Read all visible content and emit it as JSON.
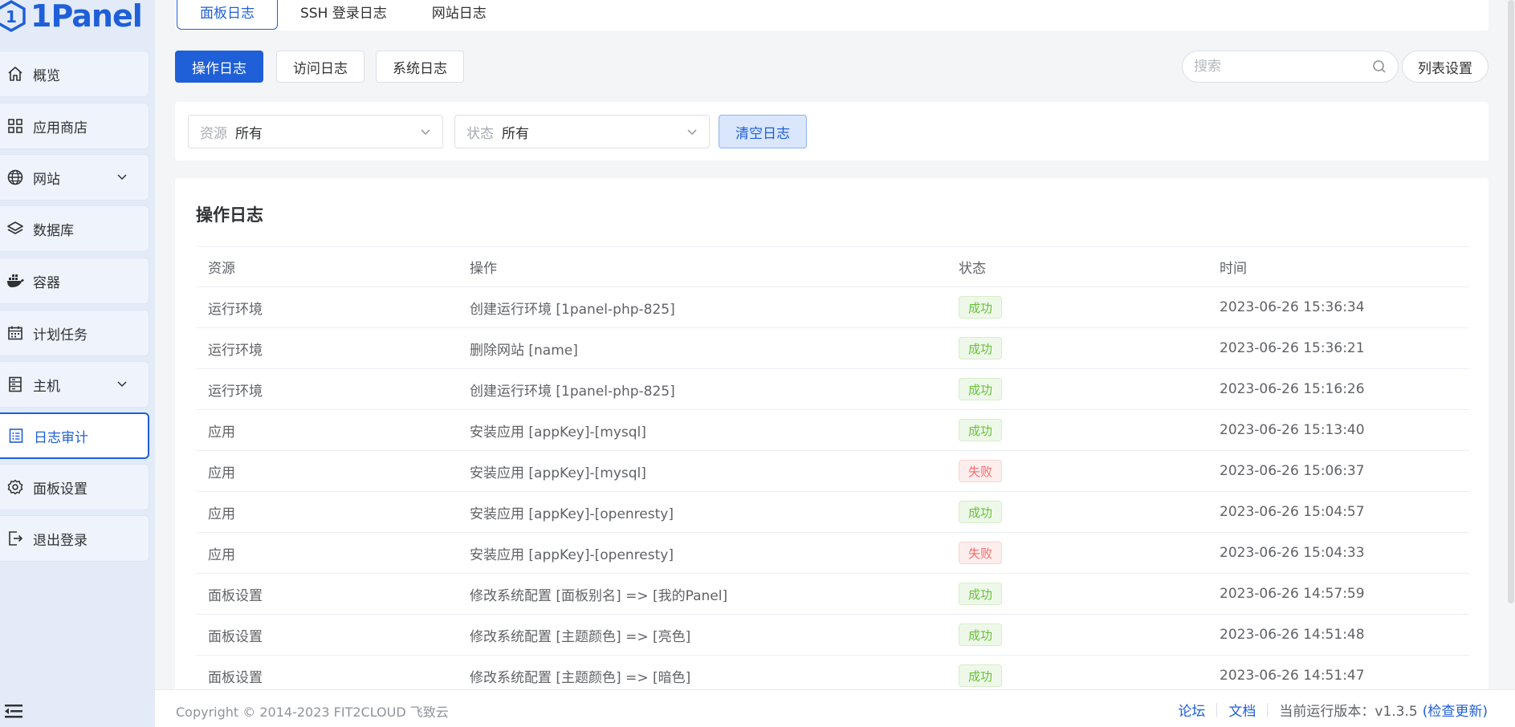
{
  "app": {
    "logo_text": "1Panel"
  },
  "sidebar": {
    "items": [
      {
        "label": "概览",
        "icon": "home-icon",
        "has_arrow": false,
        "active": false
      },
      {
        "label": "应用商店",
        "icon": "grid-icon",
        "has_arrow": false,
        "active": false
      },
      {
        "label": "网站",
        "icon": "globe-icon",
        "has_arrow": true,
        "active": false
      },
      {
        "label": "数据库",
        "icon": "layers-icon",
        "has_arrow": false,
        "active": false
      },
      {
        "label": "容器",
        "icon": "docker-icon",
        "has_arrow": false,
        "active": false
      },
      {
        "label": "计划任务",
        "icon": "calendar-icon",
        "has_arrow": false,
        "active": false
      },
      {
        "label": "主机",
        "icon": "server-icon",
        "has_arrow": true,
        "active": false
      },
      {
        "label": "日志审计",
        "icon": "log-icon",
        "has_arrow": false,
        "active": true
      },
      {
        "label": "面板设置",
        "icon": "gear-icon",
        "has_arrow": false,
        "active": false
      },
      {
        "label": "退出登录",
        "icon": "logout-icon",
        "has_arrow": false,
        "active": false
      }
    ]
  },
  "top_tabs": [
    {
      "label": "面板日志",
      "active": true
    },
    {
      "label": "SSH 登录日志",
      "active": false
    },
    {
      "label": "网站日志",
      "active": false
    }
  ],
  "sub_tabs": [
    {
      "label": "操作日志",
      "active": true
    },
    {
      "label": "访问日志",
      "active": false
    },
    {
      "label": "系统日志",
      "active": false
    }
  ],
  "search": {
    "placeholder": "搜索"
  },
  "list_settings_label": "列表设置",
  "filters": {
    "resource": {
      "prefix": "资源",
      "value": "所有"
    },
    "status": {
      "prefix": "状态",
      "value": "所有"
    },
    "clear_label": "清空日志"
  },
  "table": {
    "title": "操作日志",
    "headers": [
      "资源",
      "操作",
      "状态",
      "时间"
    ],
    "rows": [
      {
        "resource": "运行环境",
        "operation": "创建运行环境 [1panel-php-825]",
        "status": "成功",
        "ok": true,
        "time": "2023-06-26 15:36:34"
      },
      {
        "resource": "运行环境",
        "operation": "删除网站 [name]",
        "status": "成功",
        "ok": true,
        "time": "2023-06-26 15:36:21"
      },
      {
        "resource": "运行环境",
        "operation": "创建运行环境 [1panel-php-825]",
        "status": "成功",
        "ok": true,
        "time": "2023-06-26 15:16:26"
      },
      {
        "resource": "应用",
        "operation": "安装应用 [appKey]-[mysql]",
        "status": "成功",
        "ok": true,
        "time": "2023-06-26 15:13:40"
      },
      {
        "resource": "应用",
        "operation": "安装应用 [appKey]-[mysql]",
        "status": "失败",
        "ok": false,
        "time": "2023-06-26 15:06:37"
      },
      {
        "resource": "应用",
        "operation": "安装应用 [appKey]-[openresty]",
        "status": "成功",
        "ok": true,
        "time": "2023-06-26 15:04:57"
      },
      {
        "resource": "应用",
        "operation": "安装应用 [appKey]-[openresty]",
        "status": "失败",
        "ok": false,
        "time": "2023-06-26 15:04:33"
      },
      {
        "resource": "面板设置",
        "operation": "修改系统配置 [面板别名] => [我的Panel]",
        "status": "成功",
        "ok": true,
        "time": "2023-06-26 14:57:59"
      },
      {
        "resource": "面板设置",
        "operation": "修改系统配置 [主题颜色] => [亮色]",
        "status": "成功",
        "ok": true,
        "time": "2023-06-26 14:51:48"
      },
      {
        "resource": "面板设置",
        "operation": "修改系统配置 [主题颜色] => [暗色]",
        "status": "成功",
        "ok": true,
        "time": "2023-06-26 14:51:47"
      }
    ]
  },
  "footer": {
    "copyright": "Copyright © 2014-2023 FIT2CLOUD 飞致云",
    "forum": "论坛",
    "docs": "文档",
    "version_text": "当前运行版本：v1.3.5",
    "check_update": "(检查更新)"
  },
  "colors": {
    "primary": "#1f5fd8",
    "success": "#67c23a",
    "danger": "#f56c6c",
    "sidebar_bg": "#e3ebf9"
  }
}
